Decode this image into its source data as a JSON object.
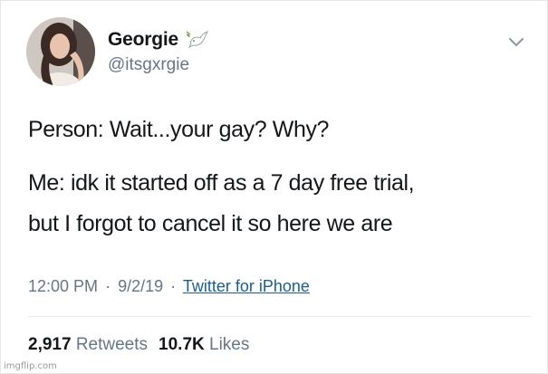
{
  "tweet": {
    "author": {
      "display_name": "Georgie",
      "handle": "@itsgxrgie",
      "badge_icon": "dove-icon",
      "avatar": "avatar-photo"
    },
    "menu_icon": "chevron-down-icon",
    "body_lines": [
      "Person: Wait...your gay? Why?",
      "Me: idk it started off as a 7 day free trial,",
      "but I forgot to cancel it so here we are"
    ],
    "time": "12:00 PM",
    "date": "9/2/19",
    "separator": "·",
    "source": "Twitter for iPhone",
    "stats": {
      "retweets_count": "2,917",
      "retweets_label": "Retweets",
      "likes_count": "10.7K",
      "likes_label": "Likes"
    }
  },
  "watermark": "imgflip.com",
  "colors": {
    "text": "#14171a",
    "secondary": "#657786",
    "link": "#1b5f8f",
    "divider": "#e1e8ed"
  }
}
